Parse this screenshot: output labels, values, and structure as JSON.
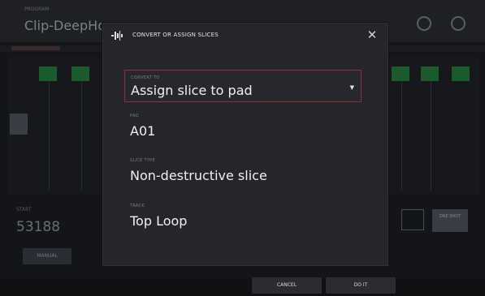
{
  "background": {
    "top_label": "PROGRAM",
    "title": "Clip-DeepHouse",
    "bpm_label": "START",
    "bpm_value": "53188",
    "mode_button": "MANUAL",
    "right_button": "ONE SHOT"
  },
  "dialog": {
    "title": "CONVERT OR ASSIGN SLICES",
    "close_icon": "close-icon",
    "header_icon": "slice-icon",
    "convert_to": {
      "label": "CONVERT TO",
      "value": "Assign slice to pad"
    },
    "pad": {
      "label": "PAD",
      "value": "A01"
    },
    "slice_type": {
      "label": "SLICE TYPE",
      "value": "Non-destructive slice"
    },
    "track": {
      "label": "TRACK",
      "value": "Top Loop"
    }
  },
  "footer": {
    "cancel_label": "CANCEL",
    "do_it_label": "DO IT"
  },
  "colors": {
    "accent": "#9a2a34",
    "dialog_bg": "#24262b",
    "pad_green": "#1b5a2a"
  }
}
